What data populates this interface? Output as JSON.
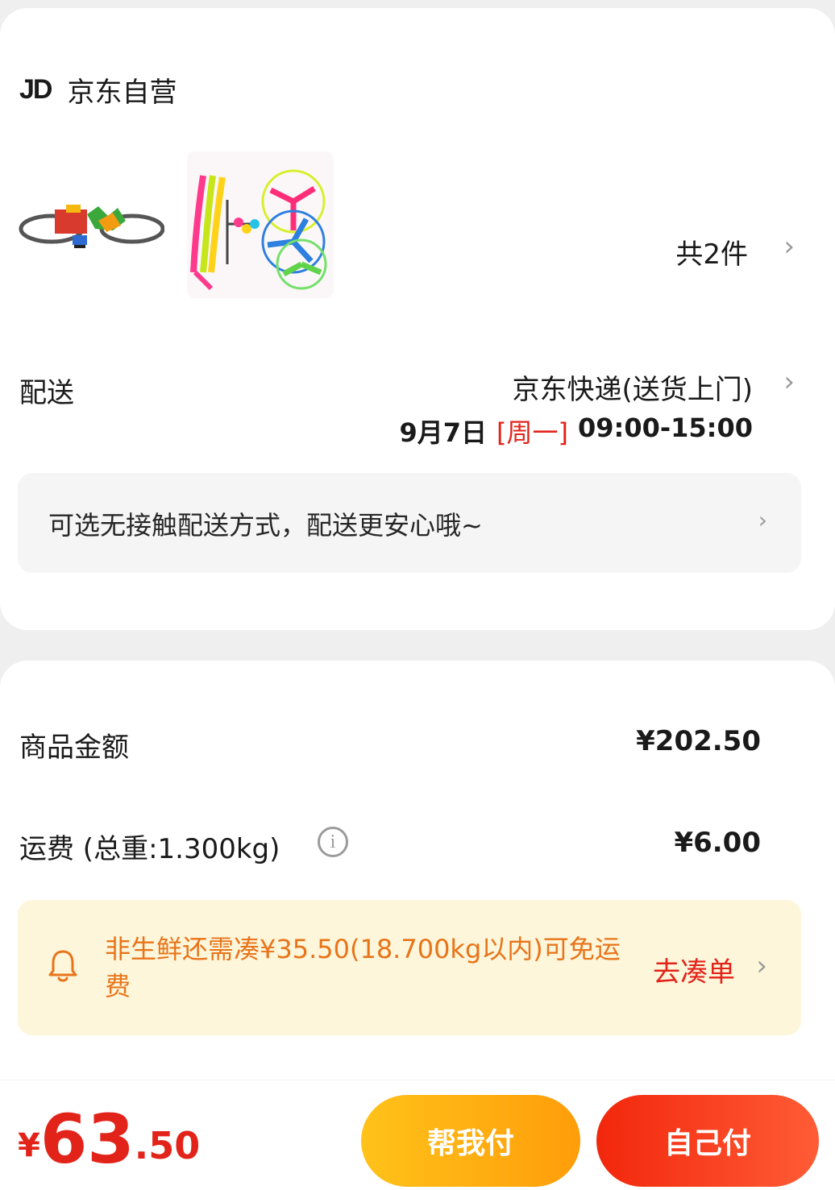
{
  "shop": {
    "logo_text": "JD",
    "name": "京东自营",
    "item_count": "共2件"
  },
  "delivery": {
    "label": "配送",
    "method": "京东快递(送货上门)",
    "date": "9月7日",
    "weekday": "[周一]",
    "time_range": "09:00-15:00"
  },
  "contactless": {
    "text": "可选无接触配送方式，配送更安心哦~"
  },
  "pricing": {
    "goods_label": "商品金额",
    "goods_value": "¥202.50",
    "shipping_label": "运费 (总重:1.300kg)",
    "shipping_value": "¥6.00"
  },
  "notice": {
    "text": "非生鲜还需凑¥35.50(18.700kg以内)可免运费",
    "link": "去凑单"
  },
  "checkout": {
    "currency": "¥",
    "total_int": "63",
    "total_dec": ".50",
    "help_pay": "帮我付",
    "self_pay": "自己付"
  },
  "icons": {
    "chevron": "chevron-right-icon",
    "info": "info-icon",
    "bell": "bell-icon"
  },
  "colors": {
    "accent_red": "#e2231a",
    "notice_orange": "#e8741a",
    "notice_bg": "#fdf6da",
    "button_yellow": "#ffb312",
    "button_red": "#f2270c"
  }
}
